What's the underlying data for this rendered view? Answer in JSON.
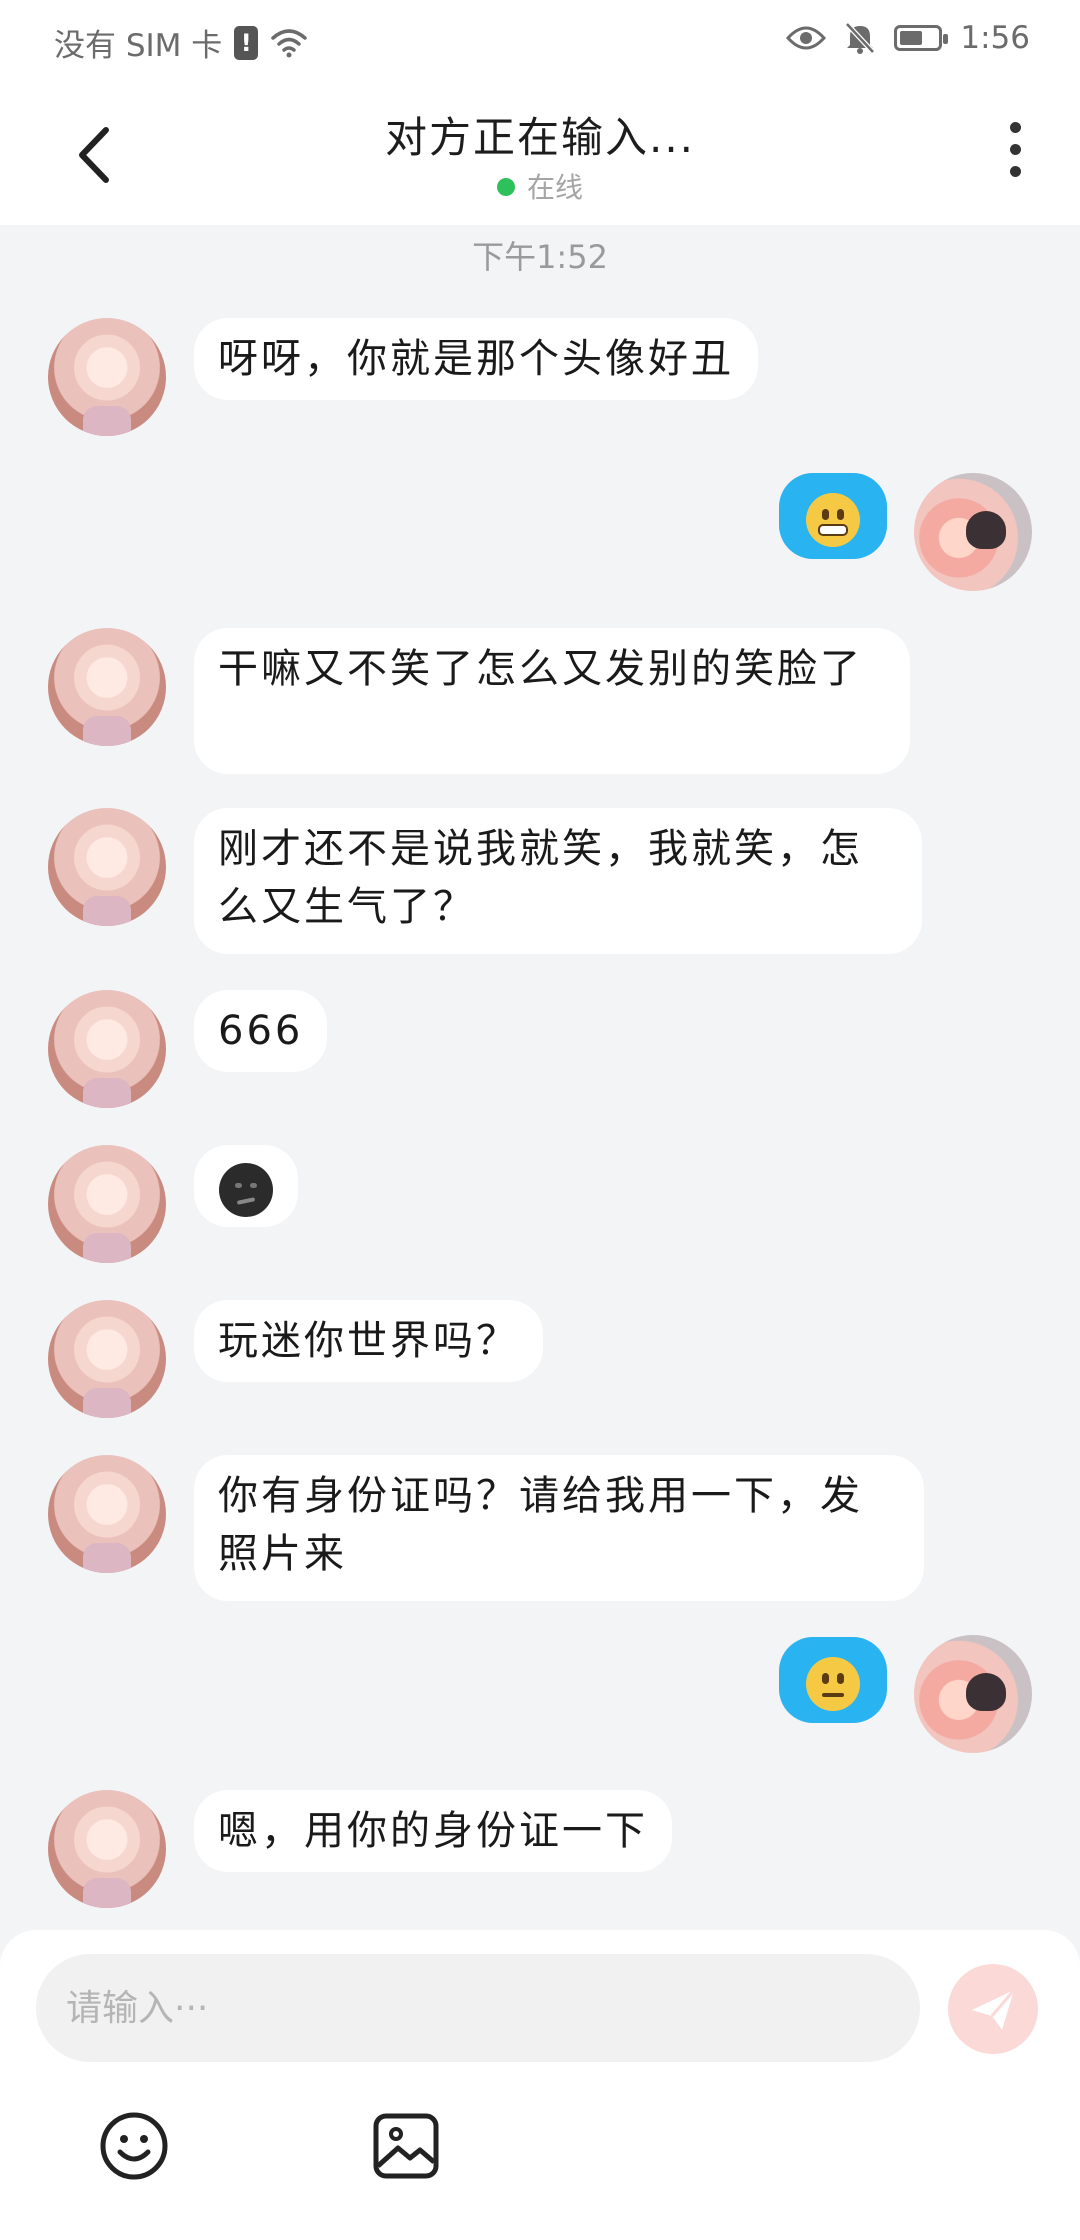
{
  "status_bar": {
    "carrier": "没有 SIM 卡",
    "alert": "!",
    "time": "1:56",
    "battery_level": 0.6
  },
  "header": {
    "title": "对方正在输入...",
    "status": "在线"
  },
  "timestamp": "下午1:52",
  "messages": [
    {
      "side": "left",
      "text": "呀呀，你就是那个头像好丑"
    },
    {
      "side": "right",
      "emoji": "grimacing-face"
    },
    {
      "side": "left",
      "text": "干嘛又不笑了怎么又发别的笑脸了"
    },
    {
      "side": "left",
      "text": "刚才还不是说我就笑，我就笑，怎么又生气了？"
    },
    {
      "side": "left",
      "text": "666"
    },
    {
      "side": "left",
      "emoji": "dark-smirk-face"
    },
    {
      "side": "left",
      "text": "玩迷你世界吗？"
    },
    {
      "side": "left",
      "text": "你有身份证吗？请给我用一下，发照片来"
    },
    {
      "side": "right",
      "emoji": "neutral-face"
    },
    {
      "side": "left",
      "text": "嗯，用你的身份证一下"
    }
  ],
  "input": {
    "placeholder": "请输入···",
    "value": ""
  },
  "icons": {
    "back": "back-arrow-icon",
    "more": "more-vertical-icon",
    "send": "send-plane-icon",
    "emoji": "smiley-icon",
    "image": "image-icon"
  },
  "colors": {
    "online": "#2ec15b",
    "self_bubble": "#29b3f1",
    "send_button": "#fbd9d6",
    "background": "#f3f4f6"
  }
}
